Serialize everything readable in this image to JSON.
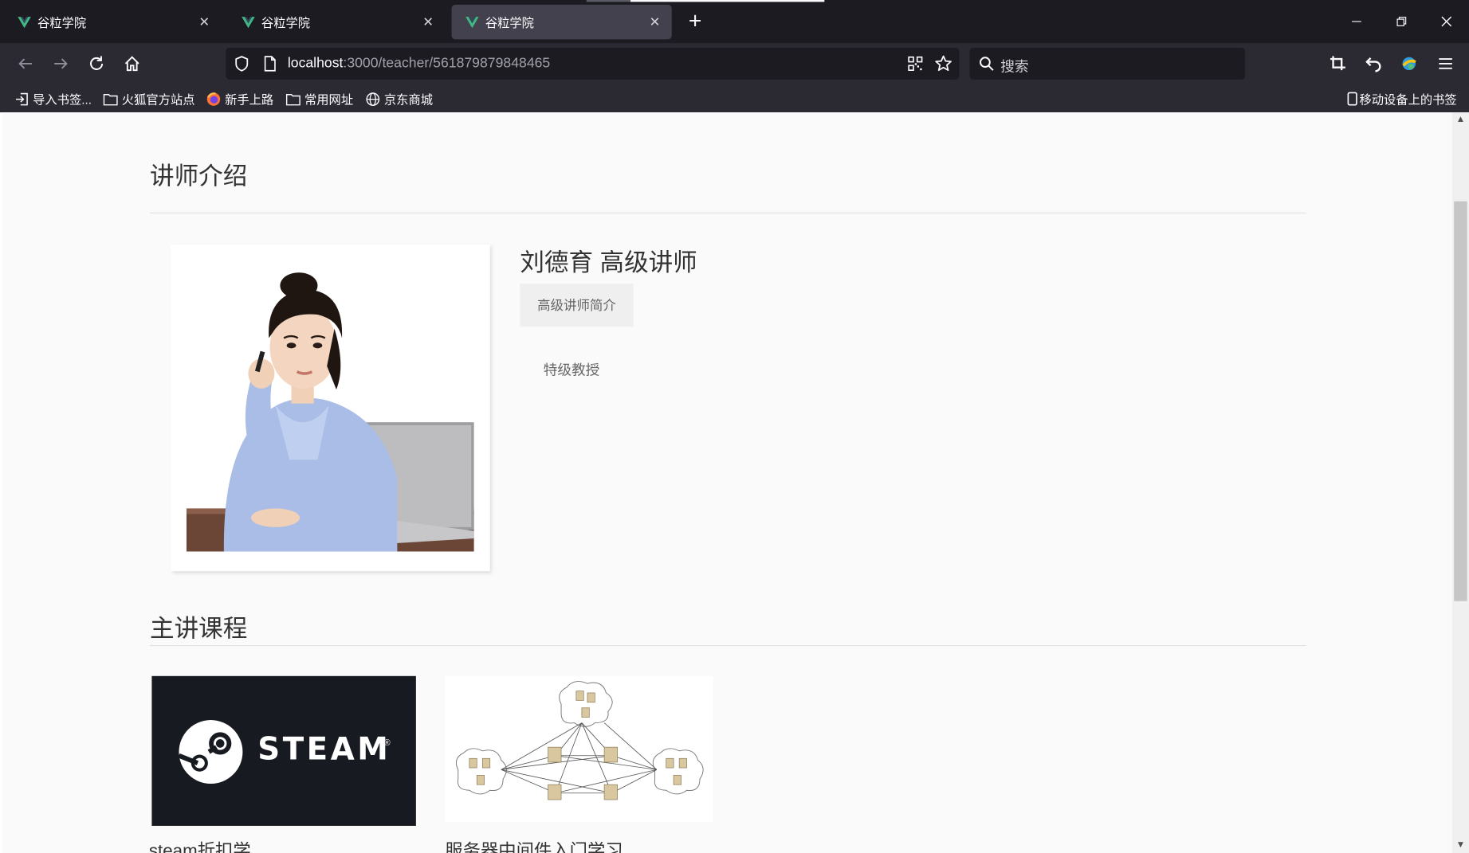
{
  "browser": {
    "tabs": [
      {
        "title": "谷粒学院",
        "active": false
      },
      {
        "title": "谷粒学院",
        "active": false
      },
      {
        "title": "谷粒学院",
        "active": true
      }
    ],
    "url_host": "localhost",
    "url_rest": ":3000/teacher/561879879848465",
    "search_placeholder": "搜索",
    "bookmarks": [
      "导入书签...",
      "火狐官方站点",
      "新手上路",
      "常用网址",
      "京东商城"
    ],
    "mobile_bookmarks": "移动设备上的书签"
  },
  "page": {
    "section_teacher_title": "讲师介绍",
    "teacher": {
      "name": "刘德育 高级讲师",
      "intro_label": "高级讲师简介",
      "career": "特级教授"
    },
    "section_courses_title": "主讲课程",
    "courses": [
      {
        "title": "steam折扣学",
        "thumb_text": "STEAM"
      },
      {
        "title": "服务器中间件入门学习",
        "thumb_text": ""
      }
    ]
  },
  "colors": {
    "browser_dark": "#1c1b22",
    "browser_toolbar": "#2b2a33",
    "page_bg": "#fafafa",
    "steam_bg": "#171a21"
  }
}
